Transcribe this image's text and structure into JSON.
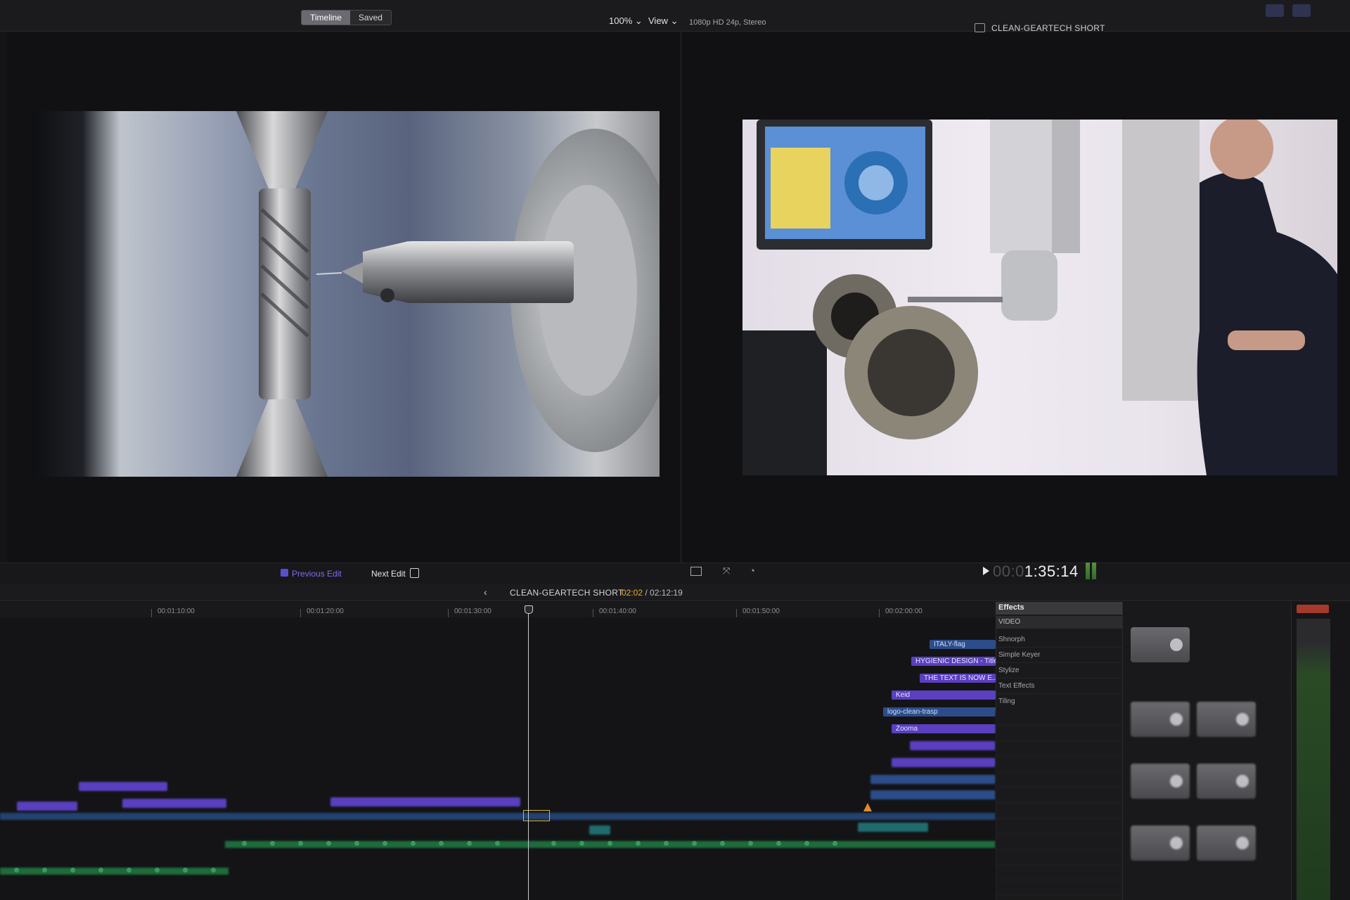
{
  "toolbar": {
    "timeline_label": "Timeline",
    "saved_label": "Saved",
    "zoom": "100%",
    "view_menu": "View",
    "format": "1080p HD 24p, Stereo",
    "project_title": "CLEAN-GEARTECH SHORT"
  },
  "viewer": {
    "prev_edit": "Previous Edit",
    "next_edit": "Next Edit",
    "timecode_dim": "00:0",
    "timecode": "1:35:14"
  },
  "timeline": {
    "project_name": "CLEAN-GEARTECH SHORT",
    "position": "02:02",
    "duration": " / 02:12:19",
    "ruler": [
      "00:01:10:00",
      "00:01:20:00",
      "00:01:30:00",
      "00:01:40:00",
      "00:01:50:00",
      "00:02:00:00"
    ],
    "clips": {
      "italy_flag": "ITALY-flag",
      "hygienic": "HYGIENIC DESIGN - Title...",
      "text_now": "THE TEXT IS NOW E...",
      "keid": "Keid",
      "logo_clean": "logo-clean-trasp",
      "zoomie": "Zooma"
    }
  },
  "effects": {
    "title": "Effects",
    "section": "VIDEO",
    "items": [
      "Shnorph",
      "Simple Keyer",
      "Stylize",
      "Text Effects",
      "Tiling"
    ]
  },
  "colors": {
    "accent_purple": "#5a3fc0",
    "playhead_time": "#f0a92a",
    "spine_blue": "#234270",
    "audio_green": "#1e6b3b"
  }
}
